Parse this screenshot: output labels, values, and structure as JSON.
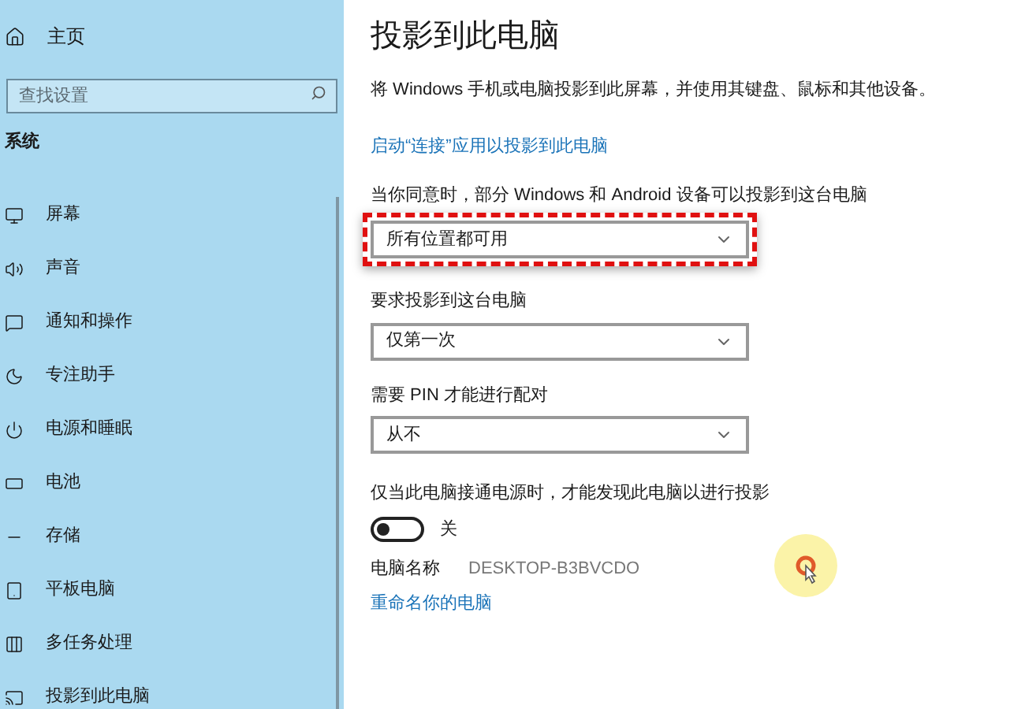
{
  "sidebar": {
    "home": "主页",
    "search": {
      "placeholder": "查找设置"
    },
    "section": "系统",
    "items": [
      {
        "label": "屏幕",
        "kind": "display"
      },
      {
        "label": "声音",
        "kind": "sound"
      },
      {
        "label": "通知和操作",
        "kind": "notify"
      },
      {
        "label": "专注助手",
        "kind": "focus"
      },
      {
        "label": "电源和睡眠",
        "kind": "power"
      },
      {
        "label": "电池",
        "kind": "battery"
      },
      {
        "label": "存储",
        "kind": "storage"
      },
      {
        "label": "平板电脑",
        "kind": "tablet"
      },
      {
        "label": "多任务处理",
        "kind": "multitask"
      },
      {
        "label": "投影到此电脑",
        "kind": "project"
      }
    ]
  },
  "page": {
    "title": "投影到此电脑",
    "description": "将 Windows 手机或电脑投影到此屏幕，并使用其键盘、鼠标和其他设备。",
    "link": "启动“连接”应用以投影到此电脑",
    "settings": [
      {
        "label": "当你同意时，部分 Windows 和 Android 设备可以投影到这台电脑",
        "value": "所有位置都可用",
        "highlighted": true
      },
      {
        "label": "要求投影到这台电脑",
        "value": "仅第一次",
        "highlighted": false
      },
      {
        "label": "需要 PIN 才能进行配对",
        "value": "从不",
        "highlighted": false
      }
    ],
    "power_toggle": {
      "label": "仅当此电脑接通电源时，才能发现此电脑以进行投影",
      "on": false,
      "state_text": "关"
    },
    "pc_name": {
      "label": "电脑名称",
      "value": "DESKTOP-B3BVCDO"
    },
    "rename_link": "重命名你的电脑"
  }
}
